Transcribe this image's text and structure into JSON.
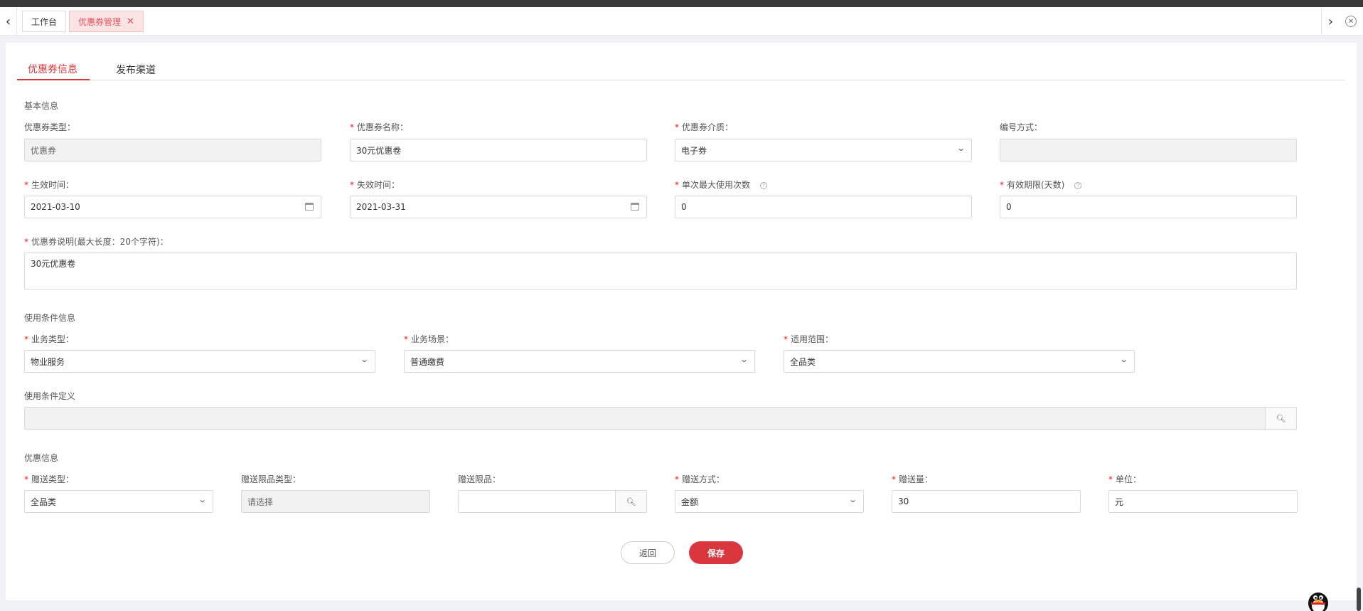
{
  "tabs": {
    "home": "工作台",
    "active": "优惠券管理"
  },
  "subtabs": [
    "优惠券信息",
    "发布渠道"
  ],
  "sections": {
    "basic": "基本信息",
    "conditions": "使用条件信息",
    "condition_def": "使用条件定义",
    "discount": "优惠信息"
  },
  "basic": {
    "coupon_type": {
      "label": "优惠券类型：",
      "value": "优惠券"
    },
    "coupon_name": {
      "label": "优惠券名称：",
      "value": "30元优惠卷"
    },
    "coupon_medium": {
      "label": "优惠券介质：",
      "value": "电子券"
    },
    "numbering": {
      "label": "编号方式：",
      "value": ""
    },
    "start_time": {
      "label": "生效时间：",
      "value": "2021-03-10"
    },
    "end_time": {
      "label": "失效时间：",
      "value": "2021-03-31"
    },
    "max_uses": {
      "label": "单次最大使用次数",
      "value": "0"
    },
    "validity_days": {
      "label": "有效期限(天数)",
      "value": "0"
    },
    "description": {
      "label": "优惠券说明(最大长度：20个字符)：",
      "value": "30元优惠卷"
    }
  },
  "conditions": {
    "business_type": {
      "label": "业务类型：",
      "value": "物业服务"
    },
    "business_scene": {
      "label": "业务场景：",
      "value": "普通缴费"
    },
    "scope": {
      "label": "适用范围：",
      "value": "全品类"
    },
    "definition": {
      "label": "使用条件定义",
      "value": ""
    }
  },
  "discount": {
    "gift_type": {
      "label": "赠送类型：",
      "value": "全品类"
    },
    "gift_limit_type": {
      "label": "赠送限品类型：",
      "value": "请选择"
    },
    "gift_limit_item": {
      "label": "赠送限品：",
      "value": ""
    },
    "gift_method": {
      "label": "赠送方式：",
      "value": "金额"
    },
    "gift_amount": {
      "label": "赠送量：",
      "value": "30"
    },
    "unit": {
      "label": "单位：",
      "value": "元"
    }
  },
  "buttons": {
    "back": "返回",
    "save": "保存"
  },
  "colors": {
    "accent": "#d9363e",
    "active_tab_bg": "#fbe3e4"
  },
  "icons": {
    "tab_close": "close-icon",
    "calendar": "calendar-icon",
    "search": "search-icon",
    "dropdown": "chevron-down-icon",
    "help": "help-icon"
  }
}
